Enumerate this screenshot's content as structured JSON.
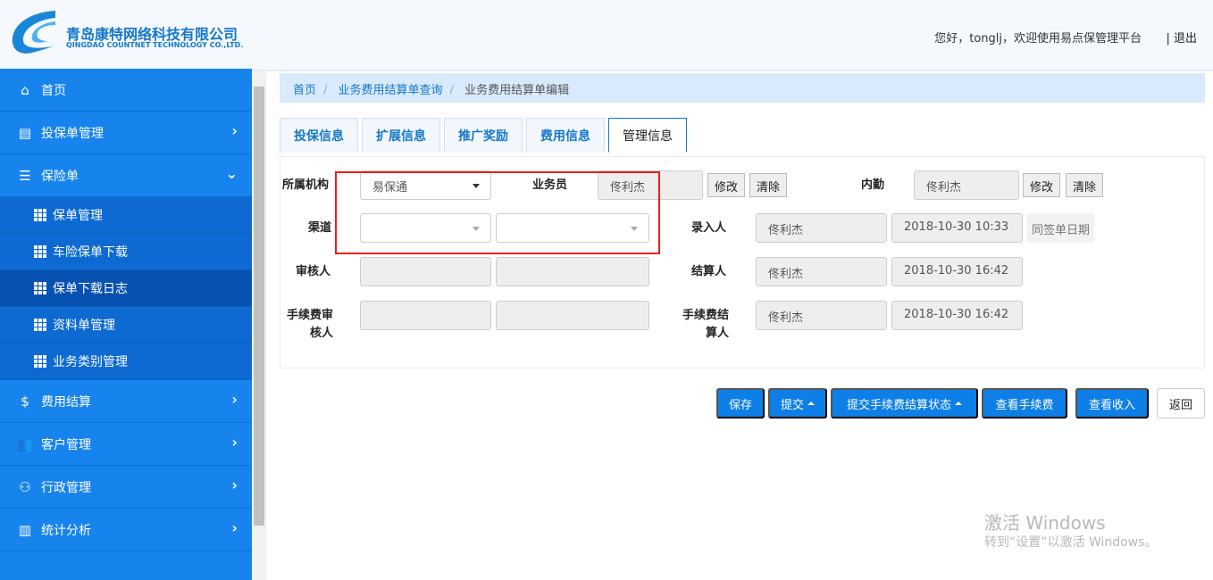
{
  "header": {
    "company_cn": "青岛康特网络科技有限公司",
    "company_en": "QINGDAO COUNTNET TECHNOLOGY CO.,LTD.",
    "greeting": "您好，tonglj，欢迎使用易点保管理平台",
    "logout": "| 退出"
  },
  "sidebar": {
    "items": [
      {
        "label": "首页",
        "icon": "home-icon",
        "glyph": "⌂"
      },
      {
        "label": "投保单管理",
        "icon": "document-icon",
        "glyph": "▤",
        "chev": "›"
      },
      {
        "label": "保险单",
        "icon": "list-icon",
        "glyph": "☰",
        "chev": "⌄"
      },
      {
        "label": "费用结算",
        "icon": "money-bag-icon",
        "glyph": "$",
        "chev": "›"
      },
      {
        "label": "客户管理",
        "icon": "users-icon",
        "glyph": "👥",
        "chev": "›"
      },
      {
        "label": "行政管理",
        "icon": "group-icon",
        "glyph": "⚇",
        "chev": "›"
      },
      {
        "label": "统计分析",
        "icon": "bar-chart-icon",
        "glyph": "▥",
        "chev": "›"
      }
    ],
    "sub_items": [
      "保单管理",
      "车险保单下载",
      "保单下载日志",
      "资料单管理",
      "业务类别管理"
    ]
  },
  "breadcrumb": [
    "首页",
    "业务费用结算单查询",
    "业务费用结算单编辑"
  ],
  "tabs": [
    "投保信息",
    "扩展信息",
    "推广奖励",
    "费用信息",
    "管理信息"
  ],
  "form": {
    "org_label": "所属机构",
    "org_value": "易保通",
    "salesman_label": "业务员",
    "salesman_value": "佟利杰",
    "modify": "修改",
    "clear": "清除",
    "internal_label": "内勤",
    "internal_value": "佟利杰",
    "channel_label": "渠道",
    "entry_label": "录入人",
    "entry_value": "佟利杰",
    "entry_time": "2018-10-30 10:33",
    "same_date": "同签单日期",
    "reviewer_label": "审核人",
    "settler_label": "结算人",
    "settler_value": "佟利杰",
    "settle_time": "2018-10-30 16:42",
    "fee_reviewer_label": "手续费审核人",
    "fee_settler_label": "手续费结算人",
    "fee_settler_value": "佟利杰",
    "fee_settle_time": "2018-10-30 16:42"
  },
  "buttons": {
    "save": "保存",
    "submit": "提交",
    "submit_fee_status": "提交手续费结算状态",
    "view_fee": "查看手续费",
    "view_income": "查看收入",
    "back": "返回"
  },
  "watermark": {
    "line1": "激活 Windows",
    "line2": "转到“设置”以激活 Windows。"
  }
}
